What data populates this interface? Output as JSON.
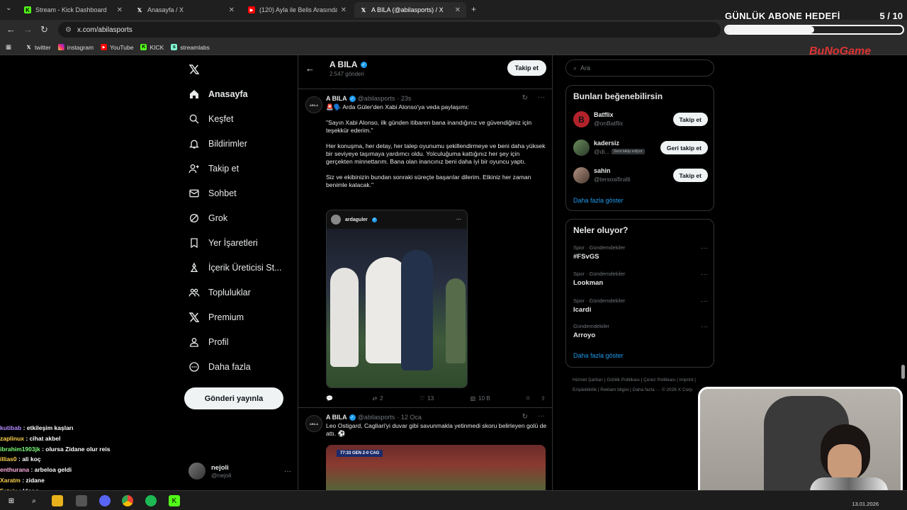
{
  "browser": {
    "tabs": [
      {
        "label": "Stream - Kick Dashboard",
        "icon": "kick-icon"
      },
      {
        "label": "Anasayfa / X",
        "icon": "x-icon"
      },
      {
        "label": "(120) Ayla ile Belis Arasında Kri...",
        "icon": "youtube-icon"
      },
      {
        "label": "A BILA (@abilasports) / X",
        "icon": "x-icon"
      }
    ],
    "url": "x.com/abilasports",
    "bookmarks": [
      {
        "label": "twitter",
        "icon": "x-icon"
      },
      {
        "label": "instagram",
        "icon": "instagram-icon"
      },
      {
        "label": "YouTube",
        "icon": "youtube-icon"
      },
      {
        "label": "KICK",
        "icon": "kick-icon"
      },
      {
        "label": "streamlabs",
        "icon": "streamlabs-icon"
      }
    ]
  },
  "overlay": {
    "goal_label": "GÜNLÜK ABONE HEDEFİ",
    "goal_count": "5 / 10",
    "goal_progress": 0.5,
    "logo": "BuNoGame"
  },
  "nav": {
    "items": [
      {
        "label": "Anasayfa",
        "icon": "home-icon"
      },
      {
        "label": "Keşfet",
        "icon": "search-icon"
      },
      {
        "label": "Bildirimler",
        "icon": "bell-icon"
      },
      {
        "label": "Takip et",
        "icon": "add-user-icon"
      },
      {
        "label": "Sohbet",
        "icon": "mail-icon"
      },
      {
        "label": "Grok",
        "icon": "grok-icon"
      },
      {
        "label": "Yer İşaretleri",
        "icon": "bookmark-icon"
      },
      {
        "label": "İçerik Üreticisi St...",
        "icon": "creator-icon"
      },
      {
        "label": "Topluluklar",
        "icon": "communities-icon"
      },
      {
        "label": "Premium",
        "icon": "x-icon"
      },
      {
        "label": "Profil",
        "icon": "profile-icon"
      },
      {
        "label": "Daha fazla",
        "icon": "more-icon"
      }
    ],
    "post_button": "Gönderi yayınla",
    "account_name": "nejoli",
    "account_handle": "@nejoli"
  },
  "profile_header": {
    "name": "A BILA",
    "posts": "2.547 gönderi",
    "follow": "Takip et"
  },
  "tweets": [
    {
      "name": "A BILA",
      "handle": "@abilasports",
      "time": "· 23s",
      "text": "🚨🗣️ Arda Güler'den Xabi Alonso'ya veda paylaşımı:\n\n\"Sayın Xabi Alonso, ilk günden itibaren bana inandığınız ve güvendiğiniz için teşekkür ederim.\"\n\nHer konuşma, her detay, her talep oyunumu şekillendirmeye ve beni daha yüksek bir seviyeye taşımaya yardımcı oldu. Yolculuğuma kattığınız her şey için gerçekten minnettarım. Bana olan inancınız beni daha iyi bir oyuncu yaptı.\n\nSiz ve ekibinizin bundan sonraki süreçte başarılar dilerim. Etkiniz her zaman benimle kalacak.\"",
      "embed_user": "ardaguler",
      "replies": "",
      "reposts": "2",
      "likes": "13",
      "views": "10 B"
    },
    {
      "name": "A BILA",
      "handle": "@abilasports",
      "time": "· 12 Oca",
      "text": "Leo Ostigard, Cagliari'yi duvar gibi savunmakla yetinmedi skoru belirleyen golü de attı. ⚽",
      "scoreboard": "77:33  GEN  2-0  CAG"
    }
  ],
  "right": {
    "search_placeholder": "Ara",
    "who_title": "Bunları beğenebilirsin",
    "who": [
      {
        "name": "Batflix",
        "handle": "@onBatflix",
        "button": "Takip et",
        "badge": ""
      },
      {
        "name": "kadersiz",
        "handle": "@di...",
        "button": "Geri takip et",
        "badge": "Seni takip ediyor"
      },
      {
        "name": "sahin",
        "handle": "@tersosifiralti",
        "button": "Takip et",
        "badge": ""
      }
    ],
    "show_more": "Daha fazla göster",
    "trends_title": "Neler oluyor?",
    "trends": [
      {
        "category": "Spor · Gündemdekiler",
        "name": "#FSvGS"
      },
      {
        "category": "Spor · Gündemdekiler",
        "name": "Lookman"
      },
      {
        "category": "Spor · Gündemdekiler",
        "name": "Icardi"
      },
      {
        "category": "Gündemdekiler",
        "name": "Arroyo"
      }
    ],
    "footer": "Hizmet Şartları  |  Gizlilik Politikası  |  Çerez Politikası  |  Imprint  |  Erişilebilirlik  |  Reklam bilgisi  |  Daha fazla ···  © 2026 X Corp."
  },
  "chat": [
    {
      "user": "kutibab",
      "msg": "etkileşim kaşları",
      "color": "#b58cff"
    },
    {
      "user": "zaplinux",
      "msg": "cihat akbel",
      "color": "#ffd34d"
    },
    {
      "user": "ibrahim1903jk",
      "msg": "olursa Zidane olur reis",
      "color": "#7cff7c"
    },
    {
      "user": "illias0",
      "msg": "ali koç",
      "color": "#ffd34d"
    },
    {
      "user": "enthurana",
      "msg": "arbeloa geldi",
      "color": "#ffb0e0"
    },
    {
      "user": "Xaratm",
      "msg": "zidane",
      "color": "#ffd34d"
    },
    {
      "user": "Fatsix",
      "msg": "kloog",
      "color": "#ffd34d"
    }
  ],
  "taskbar": {
    "clock": "13.01.2026"
  }
}
